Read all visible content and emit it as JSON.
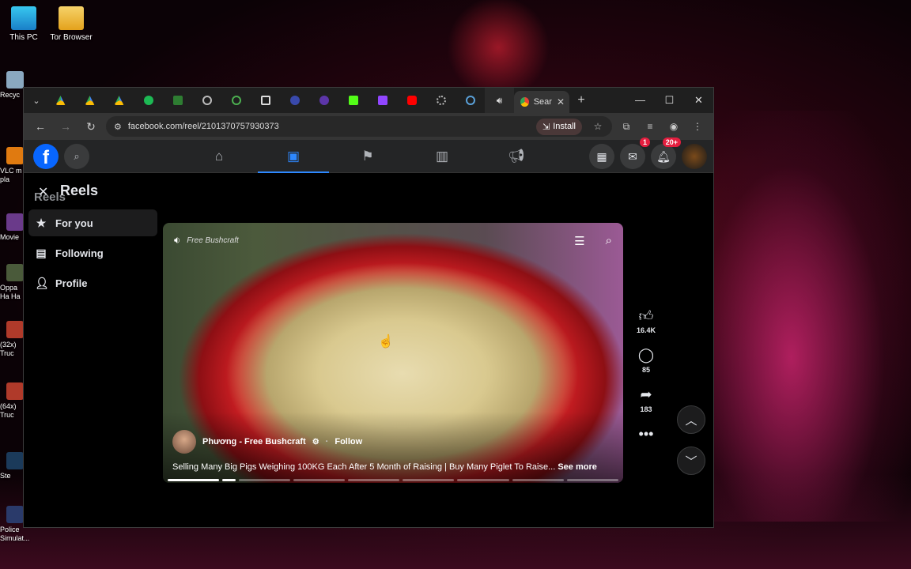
{
  "desktop": {
    "icons": [
      {
        "label": "This PC"
      },
      {
        "label": "Tor Browser"
      }
    ],
    "side_labels": [
      "Recyc",
      "VLC m pla",
      "Movie",
      "Oppa Ha Ha",
      "(32x) Truc",
      "(64x) Truc",
      "Ste",
      "Police Simulat..."
    ]
  },
  "browser": {
    "active_tab_label": "Sear",
    "url": "facebook.com/reel/2101370757930373",
    "install_label": "Install"
  },
  "facebook": {
    "messenger_badge": "1",
    "notification_badge": "20+"
  },
  "reels": {
    "title": "Reels",
    "subtitle": "Reels",
    "sidebar": [
      {
        "label": "For you"
      },
      {
        "label": "Following"
      },
      {
        "label": "Profile"
      }
    ],
    "video": {
      "watermark": "Free Bushcraft",
      "author": "Phương - Free Bushcraft",
      "follow_label": "Follow",
      "caption": "Selling Many Big Pigs Weighing 100KG Each After 5 Month of Raising | Buy Many Piglet To Raise...",
      "see_more": "See more"
    },
    "actions": {
      "likes": "16.4K",
      "comments": "85",
      "shares": "183"
    }
  },
  "colors": {
    "facebook_blue": "#0866ff",
    "active_nav": "#2d88ff",
    "badge_red": "#e41e3f"
  }
}
